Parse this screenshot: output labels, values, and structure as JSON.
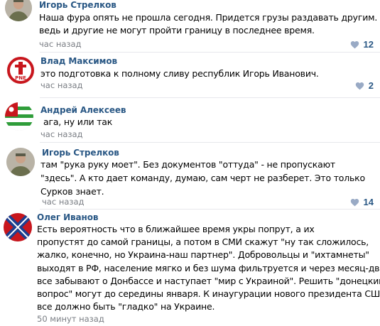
{
  "comments": [
    {
      "author": "Игорь Стрелков",
      "lines": [
        "Наша фура опять не прошла сегодня. Придется грузы раздавать другим. Но",
        "ведь и другие не могут пройти границу в последнее время."
      ],
      "time": "час назад",
      "likes": "12",
      "avatar": "avatar-man-in-uniform"
    },
    {
      "author": "Влад Максимов",
      "lines": [
        "это подготовка к полному сливу республик Игорь Иванович."
      ],
      "time": "час назад",
      "likes": "2",
      "avatar": "avatar-red-emblem"
    },
    {
      "author": "Андрей Алексеев",
      "lines": [
        "ага, ну или так"
      ],
      "time": "час назад",
      "likes": "",
      "avatar": "avatar-abkhazia-flag"
    },
    {
      "author": "Игорь Стрелков",
      "lines": [
        "там \"рука руку моет\". Без документов \"оттуда\" - не пропускают",
        "\"здесь\". А кто дает команду, думаю, сам черт не разберет. Это только",
        "Сурков знает."
      ],
      "time": "час назад",
      "likes": "14",
      "avatar": "avatar-man-in-uniform"
    },
    {
      "author": "Олег Иванов",
      "lines": [
        "Есть вероятность что в ближайшее время укры попрут, а их",
        "пропустят до самой границы, а потом в СМИ скажут \"ну так сложилось,",
        "жалко, конечно, но Украина-наш партнер\". Добровольцы и \"ихтамнеты\"",
        "выходят в РФ, население мягко и без шума фильтруется и через месяц-два",
        "все забывают о Донбассе и наступает \"мир с Украиной\". Решить \"донецкий",
        "вопрос\" могут до середины января. К инаугурации нового президента США",
        "все должно быть \"гладко\" на Украине."
      ],
      "time": "50 минут назад",
      "likes": "",
      "avatar": "avatar-novorossiya-flag"
    }
  ],
  "colors": {
    "author": "#2a5885",
    "time": "#7a7e84",
    "heart": "#99aac5",
    "divider": "#e7e8ec"
  },
  "icons": {
    "like": "heart-icon"
  }
}
